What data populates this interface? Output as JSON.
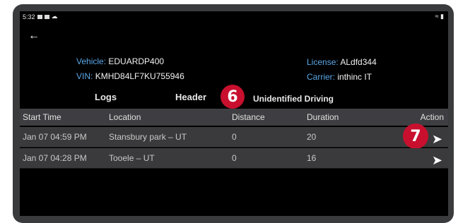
{
  "status": {
    "time": "5:32",
    "icons": [
      "notification-icon",
      "image-icon",
      "cloud-icon"
    ],
    "right_icons": [
      "wifi-icon",
      "battery-icon"
    ]
  },
  "vehicle_info": {
    "vehicle_label": "Vehicle:",
    "vehicle_value": "EDUARDP400",
    "vin_label": "VIN:",
    "vin_value": "KMHD84LF7KU755946",
    "license_label": "License:",
    "license_value": "ALdfd344",
    "carrier_label": "Carrier:",
    "carrier_value": "inthinc IT"
  },
  "tabs": {
    "logs": "Logs",
    "header": "Header",
    "unidentified": "Unidentified Driving"
  },
  "callouts": {
    "tabs_marker": "6",
    "action_marker": "7"
  },
  "table": {
    "headers": {
      "start_time": "Start Time",
      "location": "Location",
      "distance": "Distance",
      "duration": "Duration",
      "action": "Action"
    },
    "rows": [
      {
        "start_time": "Jan 07 04:59 PM",
        "location": "Stansbury park – UT",
        "distance": "0",
        "duration": "20",
        "action_icon": "chevron-right-icon"
      },
      {
        "start_time": "Jan 07 04:28 PM",
        "location": "Tooele – UT",
        "distance": "0",
        "duration": "16",
        "action_icon": "chevron-right-icon"
      }
    ]
  },
  "colors": {
    "label_blue": "#5aa7e6",
    "callout_red": "#c8102e",
    "row_bg": "#3a3a3c",
    "header_bg": "#3e3e42"
  }
}
